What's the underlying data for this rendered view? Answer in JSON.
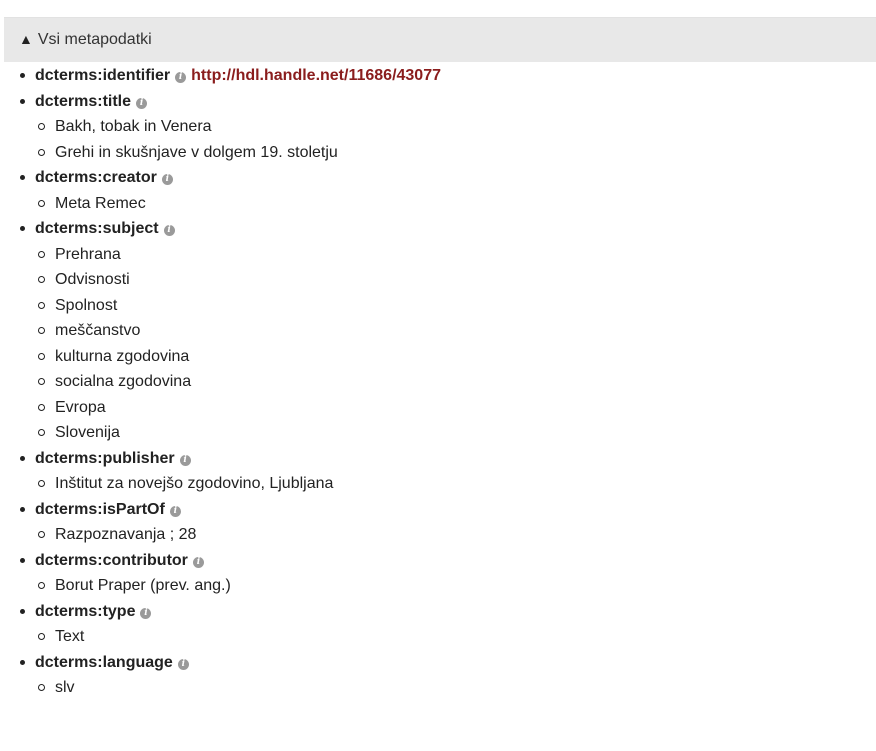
{
  "panel": {
    "toggle_glyph": "▲",
    "title": "Vsi metapodatki"
  },
  "fields": [
    {
      "name": "dcterms:identifier",
      "link": "http://hdl.handle.net/11686/43077",
      "values": []
    },
    {
      "name": "dcterms:title",
      "values": [
        "Bakh, tobak in Venera",
        "Grehi in skušnjave v dolgem 19. stoletju"
      ]
    },
    {
      "name": "dcterms:creator",
      "values": [
        "Meta Remec"
      ]
    },
    {
      "name": "dcterms:subject",
      "values": [
        "Prehrana",
        "Odvisnosti",
        "Spolnost",
        "meščanstvo",
        "kulturna zgodovina",
        "socialna zgodovina",
        "Evropa",
        "Slovenija"
      ]
    },
    {
      "name": "dcterms:publisher",
      "values": [
        "Inštitut za novejšo zgodovino, Ljubljana"
      ]
    },
    {
      "name": "dcterms:isPartOf",
      "values": [
        "Razpoznavanja ; 28"
      ]
    },
    {
      "name": "dcterms:contributor",
      "values": [
        "Borut Praper (prev. ang.)"
      ]
    },
    {
      "name": "dcterms:type",
      "values": [
        "Text"
      ]
    },
    {
      "name": "dcterms:language",
      "values": [
        "slv"
      ]
    }
  ],
  "icons": {
    "info": "info-icon",
    "toggle": "caret-up-icon"
  },
  "colors": {
    "link": "#8a1d1d",
    "header_bg": "#e8e8e8",
    "info_icon": "#9a9a9a"
  }
}
